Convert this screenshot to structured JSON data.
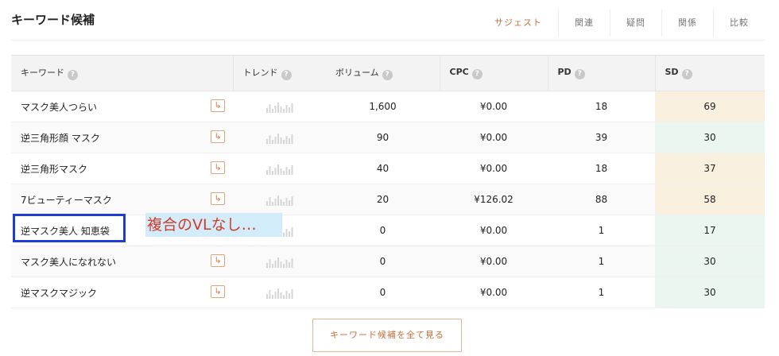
{
  "panel": {
    "title": "キーワード候補"
  },
  "tabs": [
    {
      "label": "サジェスト",
      "active": true
    },
    {
      "label": "関連",
      "active": false
    },
    {
      "label": "疑問",
      "active": false
    },
    {
      "label": "関係",
      "active": false
    },
    {
      "label": "比較",
      "active": false
    }
  ],
  "table": {
    "headers": {
      "keyword": "キーワード",
      "trend": "トレンド",
      "volume": "ボリューム",
      "cpc": "CPC",
      "pd": "PD",
      "sd": "SD"
    },
    "help_glyph": "?",
    "arrow_glyph": "↳",
    "rows": [
      {
        "keyword": "マスク美人つらい",
        "volume": "1,600",
        "cpc": "¥0.00",
        "pd": "18",
        "sd": "69",
        "sd_level": "warm",
        "has_arrow": true
      },
      {
        "keyword": "逆三角形顔 マスク",
        "volume": "90",
        "cpc": "¥0.00",
        "pd": "39",
        "sd": "30",
        "sd_level": "cool",
        "has_arrow": true
      },
      {
        "keyword": "逆三角形マスク",
        "volume": "40",
        "cpc": "¥0.00",
        "pd": "18",
        "sd": "37",
        "sd_level": "warm",
        "has_arrow": true
      },
      {
        "keyword": "7ビューティーマスク",
        "volume": "20",
        "cpc": "¥126.02",
        "pd": "88",
        "sd": "58",
        "sd_level": "warm",
        "has_arrow": true
      },
      {
        "keyword": "逆マスク美人 知恵袋",
        "volume": "0",
        "cpc": "¥0.00",
        "pd": "1",
        "sd": "17",
        "sd_level": "cool",
        "has_arrow": false
      },
      {
        "keyword": "マスク美人になれない",
        "volume": "0",
        "cpc": "¥0.00",
        "pd": "1",
        "sd": "30",
        "sd_level": "cool",
        "has_arrow": true
      },
      {
        "keyword": "逆マスクマジック",
        "volume": "0",
        "cpc": "¥0.00",
        "pd": "1",
        "sd": "30",
        "sd_level": "cool",
        "has_arrow": true
      }
    ]
  },
  "annotation": {
    "text": "複合のVLなし…"
  },
  "more_button": {
    "label": "キーワード候補を全て見る"
  },
  "colors": {
    "accent": "#c6703d",
    "highlight_border": "#1e3ed1",
    "annotation_text": "#d23b2a",
    "sd_warm": "#f8efdf",
    "sd_cool": "#ecf6f0"
  }
}
